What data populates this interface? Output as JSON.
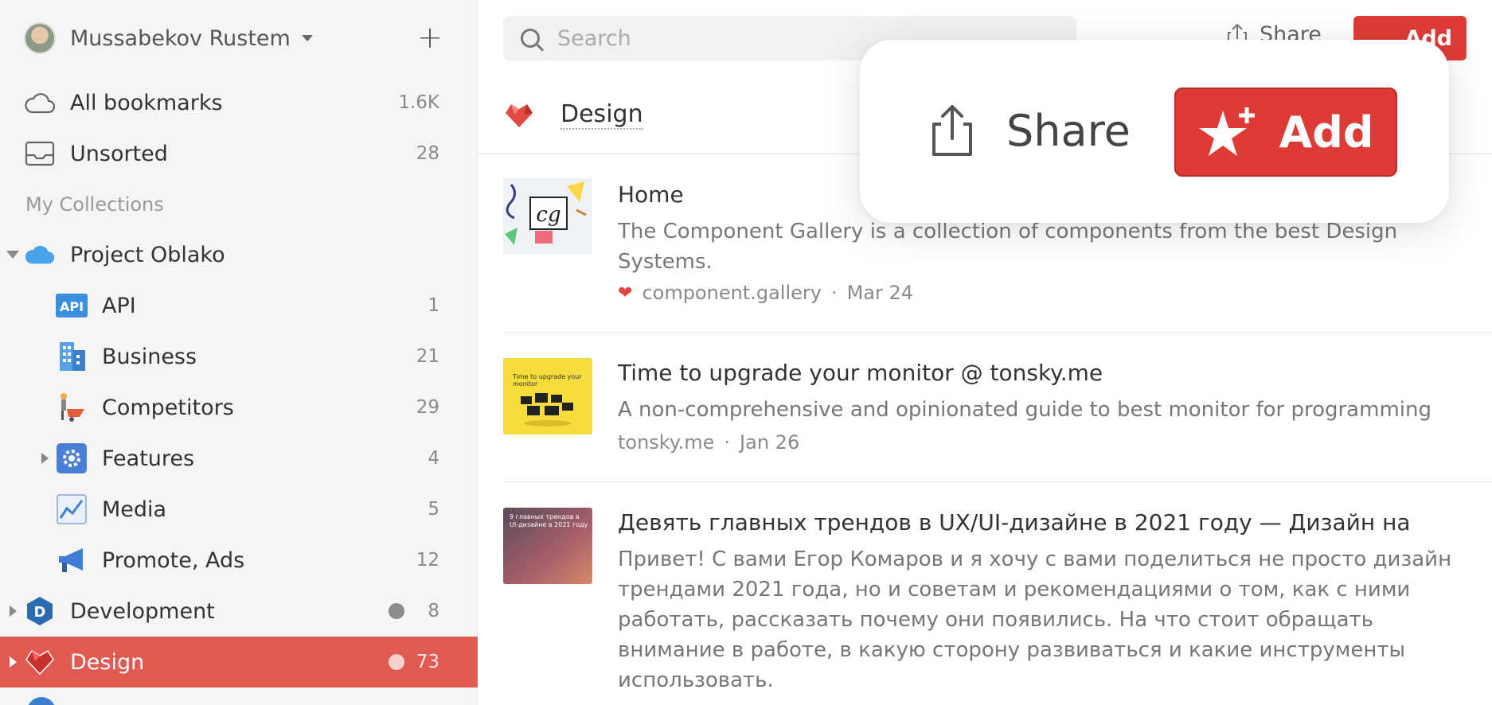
{
  "sidebar": {
    "user_name": "Mussabekov Rustem",
    "add_label": "+",
    "all_bookmarks": {
      "label": "All bookmarks",
      "count": "1.6K"
    },
    "unsorted": {
      "label": "Unsorted",
      "count": "28"
    },
    "section_title": "My Collections",
    "collections": [
      {
        "label": "Project Oblako",
        "count": ""
      },
      {
        "label": "API",
        "count": "1"
      },
      {
        "label": "Business",
        "count": "21"
      },
      {
        "label": "Competitors",
        "count": "29"
      },
      {
        "label": "Features",
        "count": "4"
      },
      {
        "label": "Media",
        "count": "5"
      },
      {
        "label": "Promote, Ads",
        "count": "12"
      },
      {
        "label": "Development",
        "count": "8"
      },
      {
        "label": "Design",
        "count": "73"
      }
    ]
  },
  "header": {
    "search_placeholder": "Search",
    "share_label": "Share",
    "add_label": "Add",
    "collection_title": "Design"
  },
  "popover": {
    "share_label": "Share",
    "add_label": "Add"
  },
  "bookmarks": [
    {
      "title": "Home",
      "description": "The Component Gallery is a collection of components from the best Design Systems.",
      "domain": "component.gallery",
      "separator": "·",
      "date": "Mar 24"
    },
    {
      "title": "Time to upgrade your monitor @ tonsky.me",
      "description": "A non-comprehensive and opinionated guide to best monitor for programming",
      "domain": "tonsky.me",
      "separator": "·",
      "date": "Jan 26"
    },
    {
      "title": "Девять главных трендов в UX/UI-дизайне в 2021 году — Дизайн на",
      "description": "Привет! С вами Егор Комаров и я хочу с вами поделиться не просто дизайн трендами 2021 года, но и советам и рекомендациями о том, как с ними работать, рассказать почему они появились. На что стоит обращать внимание в работе, в какую сторону развиваться и какие инструменты использовать."
    }
  ],
  "colors": {
    "accent": "#de3b36",
    "active_row": "#e05a52"
  }
}
